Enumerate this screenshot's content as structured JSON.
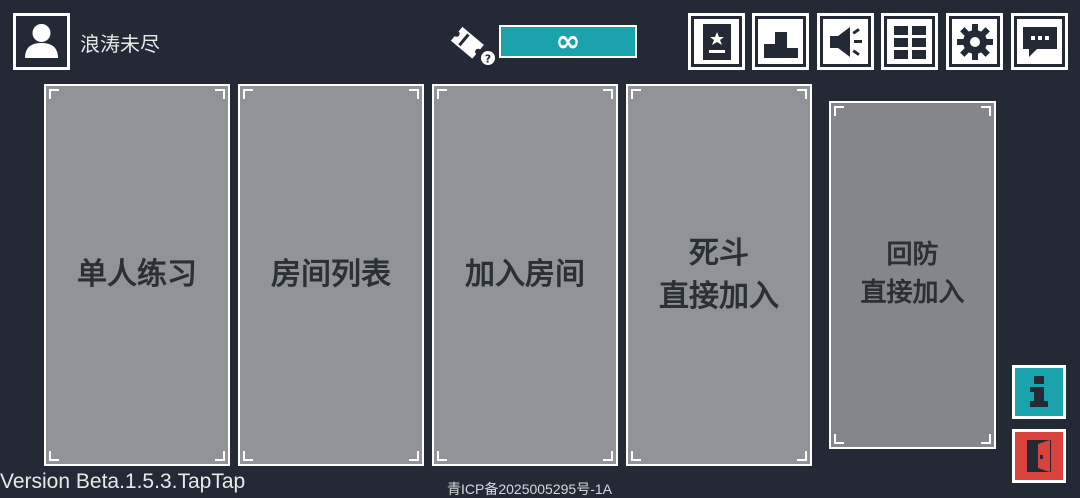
{
  "user": {
    "name": "浪涛未尽",
    "avatar_icon": "user-silhouette-icon"
  },
  "ticket": {
    "icon": "ticket-question-icon",
    "value": "∞"
  },
  "toolbar": [
    {
      "name": "profile-card-button",
      "icon": "badge-star-icon"
    },
    {
      "name": "leaderboard-button",
      "icon": "podium-icon"
    },
    {
      "name": "announcement-button",
      "icon": "megaphone-icon"
    },
    {
      "name": "grid-menu-button",
      "icon": "grid-icon"
    },
    {
      "name": "settings-button",
      "icon": "gear-icon"
    },
    {
      "name": "chat-button",
      "icon": "chat-bubble-icon"
    }
  ],
  "modes": {
    "practice": "单人练习",
    "room_list": "房间列表",
    "join_room": "加入房间",
    "deathmatch_line1": "死斗",
    "deathmatch_line2": "直接加入",
    "defense_line1": "回防",
    "defense_line2": "直接加入"
  },
  "side": {
    "info_icon": "info-icon",
    "exit_icon": "exit-door-icon"
  },
  "footer": {
    "version": "Version Beta.1.5.3.TapTap",
    "icp": "青ICP备2025005295号-1A"
  },
  "colors": {
    "background": "#232a36",
    "accent_teal": "#1aa3ac",
    "exit_red": "#d9423d",
    "card": "#909398"
  }
}
